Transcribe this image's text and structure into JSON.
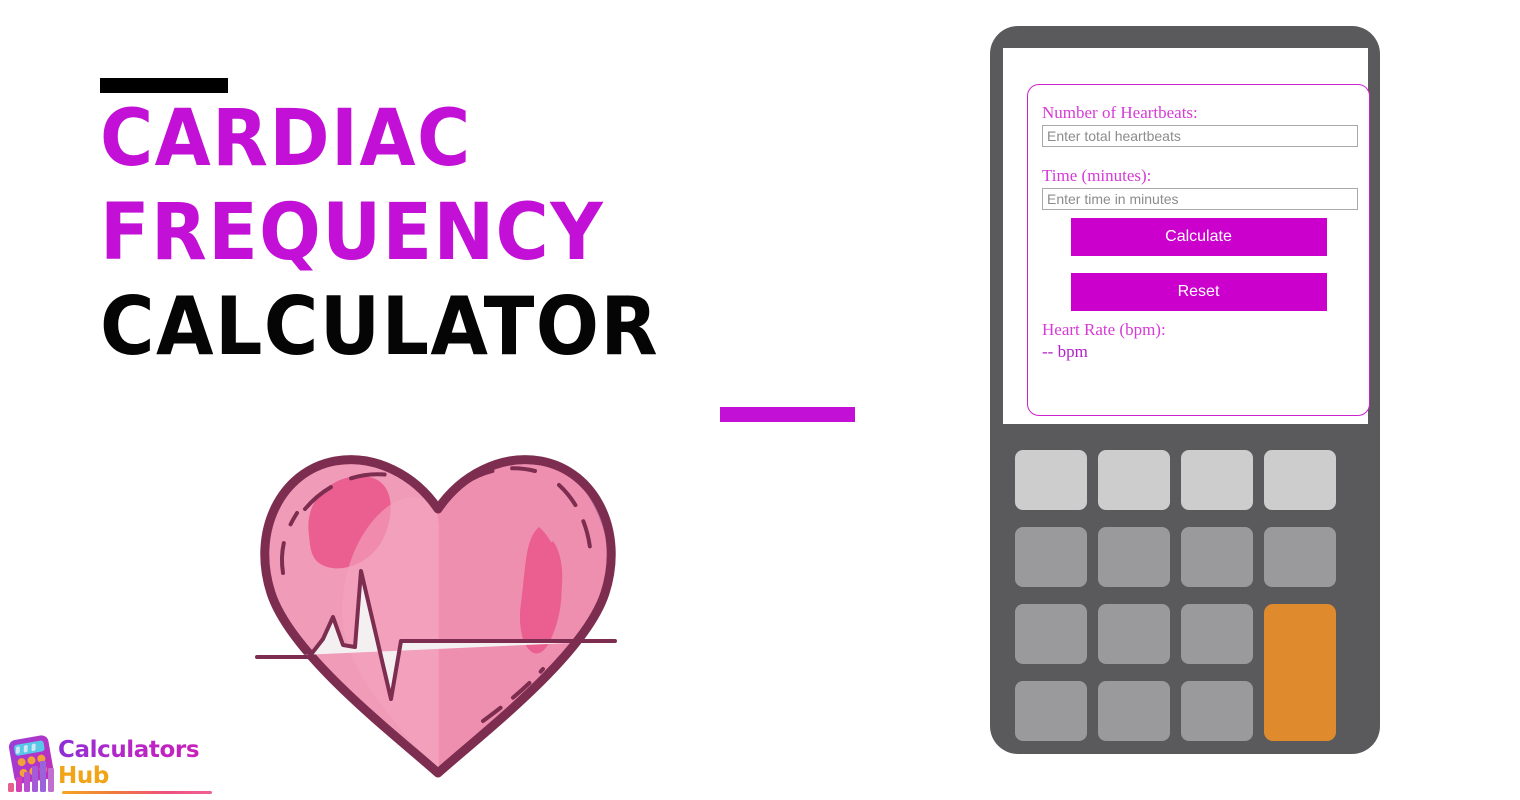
{
  "hero": {
    "title_lines": [
      "CARDIAC",
      "FREQUENCY",
      "CALCULATOR"
    ],
    "accent_color": "#c210d6",
    "dark_color": "#050505",
    "rule_top_color": "#000000",
    "rule_bottom_color": "#c210d6",
    "illustration": "heart-with-ecg-line"
  },
  "logo": {
    "line1": "Calculators",
    "line2": "Hub",
    "icon": "calculator-bar-chart-icon",
    "line1_color": "#b428c8",
    "line2_color": "#f0a416"
  },
  "calculator": {
    "body_color": "#5a5a5c",
    "screen_color": "#ffffff",
    "card_border_color": "#cc22cc",
    "form": {
      "heartbeats_label": "Number of Heartbeats:",
      "heartbeats_placeholder": "Enter total heartbeats",
      "heartbeats_value": "",
      "time_label": "Time (minutes):",
      "time_placeholder": "Enter time in minutes",
      "time_value": "",
      "calculate_label": "Calculate",
      "reset_label": "Reset",
      "result_label": "Heart Rate (bpm):",
      "result_value": "-- bpm",
      "button_color": "#cc00cc",
      "label_color": "#d53bd5"
    },
    "keypad": {
      "rows": 4,
      "cols": 4,
      "key_color": "#9a9a9c",
      "top_row_color": "#cdcdce",
      "accent_key_color": "#e08a2e",
      "keys": [
        "",
        "",
        "",
        "",
        "",
        "",
        "",
        "",
        "",
        "",
        "",
        "",
        "",
        "",
        ""
      ]
    }
  }
}
